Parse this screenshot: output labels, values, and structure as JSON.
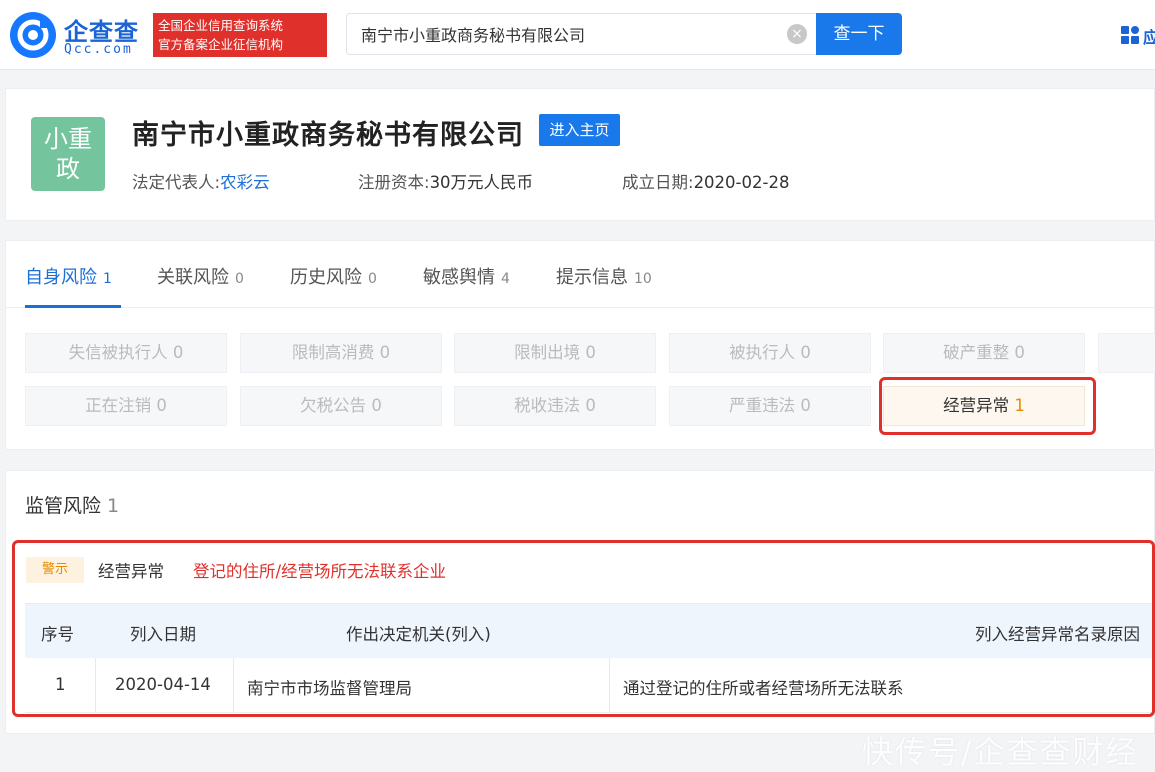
{
  "header": {
    "logo_name": "企查查",
    "logo_domain": "Qcc.com",
    "badge_line1": "全国企业信用查询系统",
    "badge_line2": "官方备案企业征信机构",
    "search_value": "南宁市小重政商务秘书有限公司",
    "clear_symbol": "×",
    "search_button": "查一下",
    "apps_label": "应"
  },
  "company": {
    "avatar_text_line1": "小重",
    "avatar_text_line2": "政",
    "avatar_color": "#74c49d",
    "name": "南宁市小重政商务秘书有限公司",
    "home_button": "进入主页",
    "legal_rep_label": "法定代表人:",
    "legal_rep_value": "农彩云",
    "capital_label": "注册资本:",
    "capital_value": "30万元人民币",
    "founded_label": "成立日期:",
    "founded_value": "2020-02-28"
  },
  "risk_tabs": [
    {
      "label": "自身风险",
      "count": "1"
    },
    {
      "label": "关联风险",
      "count": "0"
    },
    {
      "label": "历史风险",
      "count": "0"
    },
    {
      "label": "敏感舆情",
      "count": "4"
    },
    {
      "label": "提示信息",
      "count": "10"
    }
  ],
  "risk_items": [
    {
      "label": "失信被执行人",
      "count": "0"
    },
    {
      "label": "限制高消费",
      "count": "0"
    },
    {
      "label": "限制出境",
      "count": "0"
    },
    {
      "label": "被执行人",
      "count": "0"
    },
    {
      "label": "破产重整",
      "count": "0"
    },
    {
      "label": "正在注销",
      "count": "0"
    },
    {
      "label": "欠税公告",
      "count": "0"
    },
    {
      "label": "税收违法",
      "count": "0"
    },
    {
      "label": "严重违法",
      "count": "0"
    },
    {
      "label": "经营异常",
      "count": "1"
    }
  ],
  "supervision": {
    "title": "监管风险",
    "count": "1",
    "tag": "警示",
    "category": "经营异常",
    "description": "登记的住所/经营场所无法联系企业",
    "columns": [
      "序号",
      "列入日期",
      "作出决定机关(列入)",
      "列入经营异常名录原因"
    ],
    "rows": [
      {
        "index": "1",
        "date": "2020-04-14",
        "authority": "南宁市市场监督管理局",
        "reason": "通过登记的住所或者经营场所无法联系"
      }
    ]
  },
  "watermark": "快传号/企查查财经",
  "colors": {
    "brand_blue": "#1a79ea",
    "alert_red": "#e0302b",
    "warn_orange": "#e68a00"
  }
}
